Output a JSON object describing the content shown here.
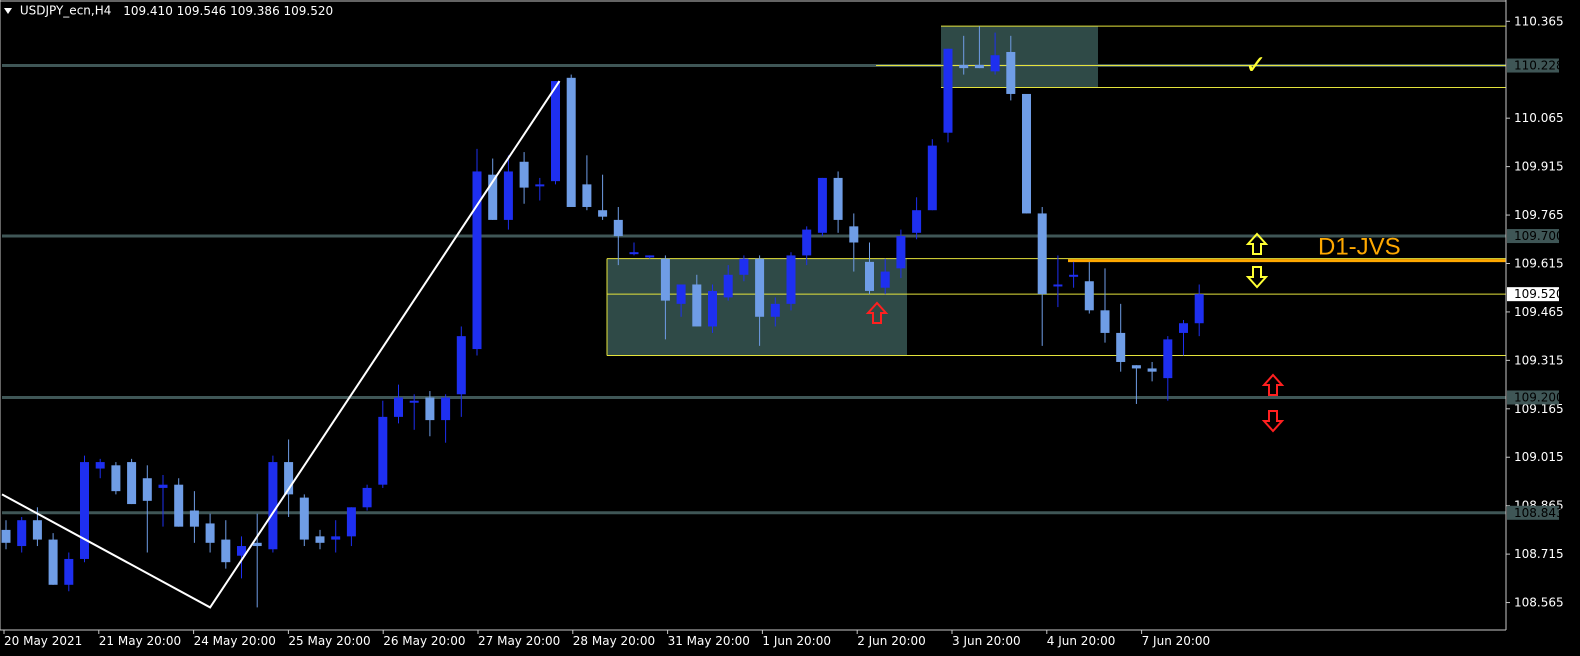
{
  "header": {
    "symbol": "USDJPY_ecn,H4",
    "ohlc": "109.410 109.546 109.386 109.520"
  },
  "colors": {
    "background": "#000000",
    "bull_body": "#1e2ff0",
    "bear_body": "#6f9de6",
    "grid_line": "#3f5656",
    "zone_fill": "#2f4a47",
    "yellow_line": "#e4e33c",
    "orange_line": "#ffa800",
    "arrow_yellow": "#ffff33",
    "arrow_red": "#ff2020"
  },
  "chart_data": {
    "type": "candlestick",
    "y_axis": {
      "min": 108.48,
      "max": 110.4,
      "ticks": [
        "110.365",
        "110.065",
        "109.915",
        "109.765",
        "109.615",
        "109.465",
        "109.315",
        "109.165",
        "109.015",
        "108.865",
        "108.715",
        "108.565"
      ]
    },
    "x_axis": {
      "labels": [
        "20 May 2021",
        "21 May 20:00",
        "24 May 20:00",
        "25 May 20:00",
        "26 May 20:00",
        "27 May 20:00",
        "28 May 20:00",
        "31 May 20:00",
        "1 Jun 20:00",
        "2 Jun 20:00",
        "3 Jun 20:00",
        "4 Jun 20:00",
        "7 Jun 20:00"
      ]
    },
    "horizontal_levels": [
      {
        "value": 110.228,
        "label": "110.228"
      },
      {
        "value": 109.7,
        "label": "109.700"
      },
      {
        "value": 109.2,
        "label": "109.200"
      },
      {
        "value": 108.843,
        "label": "108.843"
      }
    ],
    "current_price": {
      "value": 109.52,
      "label": "109.520"
    },
    "annotation": {
      "text": "D1-JVS",
      "value": 109.624
    },
    "candles": [
      [
        108.79,
        108.82,
        108.73,
        108.75
      ],
      [
        108.74,
        108.83,
        108.72,
        108.82
      ],
      [
        108.82,
        108.86,
        108.74,
        108.76
      ],
      [
        108.76,
        108.78,
        108.62,
        108.62
      ],
      [
        108.62,
        108.72,
        108.6,
        108.7
      ],
      [
        108.7,
        109.02,
        108.69,
        109.0
      ],
      [
        108.98,
        109.01,
        108.95,
        109.0
      ],
      [
        108.99,
        109.0,
        108.9,
        108.91
      ],
      [
        109.0,
        109.01,
        108.87,
        108.87
      ],
      [
        108.95,
        108.99,
        108.72,
        108.88
      ],
      [
        108.92,
        108.96,
        108.8,
        108.93
      ],
      [
        108.93,
        108.95,
        108.8,
        108.8
      ],
      [
        108.85,
        108.91,
        108.75,
        108.8
      ],
      [
        108.81,
        108.84,
        108.72,
        108.75
      ],
      [
        108.76,
        108.82,
        108.67,
        108.69
      ],
      [
        108.71,
        108.77,
        108.64,
        108.74
      ],
      [
        108.75,
        108.84,
        108.55,
        108.74
      ],
      [
        108.73,
        109.02,
        108.72,
        109.0
      ],
      [
        109.0,
        109.07,
        108.83,
        108.9
      ],
      [
        108.89,
        108.9,
        108.74,
        108.76
      ],
      [
        108.77,
        108.79,
        108.73,
        108.75
      ],
      [
        108.76,
        108.82,
        108.72,
        108.77
      ],
      [
        108.77,
        108.86,
        108.74,
        108.86
      ],
      [
        108.86,
        108.93,
        108.85,
        108.92
      ],
      [
        108.93,
        109.19,
        108.92,
        109.14
      ],
      [
        109.14,
        109.24,
        109.12,
        109.2
      ],
      [
        109.19,
        109.21,
        109.1,
        109.19
      ],
      [
        109.2,
        109.22,
        109.08,
        109.13
      ],
      [
        109.13,
        109.21,
        109.06,
        109.2
      ],
      [
        109.21,
        109.42,
        109.14,
        109.39
      ],
      [
        109.35,
        109.97,
        109.33,
        109.9
      ],
      [
        109.89,
        109.94,
        109.75,
        109.75
      ],
      [
        109.75,
        109.95,
        109.72,
        109.9
      ],
      [
        109.93,
        109.96,
        109.8,
        109.85
      ],
      [
        109.86,
        109.88,
        109.81,
        109.86
      ],
      [
        109.87,
        110.18,
        109.86,
        110.18
      ],
      [
        110.19,
        110.2,
        109.81,
        109.79
      ],
      [
        109.86,
        109.95,
        109.78,
        109.79
      ],
      [
        109.78,
        109.89,
        109.75,
        109.76
      ],
      [
        109.75,
        109.79,
        109.61,
        109.7
      ],
      [
        109.65,
        109.68,
        109.64,
        109.65
      ],
      [
        109.64,
        109.64,
        109.63,
        109.64
      ],
      [
        109.63,
        109.64,
        109.38,
        109.5
      ],
      [
        109.49,
        109.55,
        109.45,
        109.55
      ],
      [
        109.55,
        109.58,
        109.42,
        109.42
      ],
      [
        109.42,
        109.55,
        109.4,
        109.53
      ],
      [
        109.51,
        109.61,
        109.5,
        109.58
      ],
      [
        109.58,
        109.64,
        109.56,
        109.63
      ],
      [
        109.63,
        109.64,
        109.36,
        109.45
      ],
      [
        109.45,
        109.51,
        109.42,
        109.49
      ],
      [
        109.49,
        109.65,
        109.47,
        109.64
      ],
      [
        109.64,
        109.73,
        109.61,
        109.72
      ],
      [
        109.71,
        109.88,
        109.7,
        109.88
      ],
      [
        109.88,
        109.9,
        109.71,
        109.75
      ],
      [
        109.73,
        109.77,
        109.59,
        109.68
      ],
      [
        109.62,
        109.68,
        109.52,
        109.53
      ],
      [
        109.54,
        109.63,
        109.52,
        109.59
      ],
      [
        109.6,
        109.72,
        109.57,
        109.7
      ],
      [
        109.71,
        109.82,
        109.69,
        109.78
      ],
      [
        109.78,
        110.0,
        109.78,
        109.98
      ],
      [
        110.02,
        110.28,
        109.99,
        110.28
      ],
      [
        110.23,
        110.32,
        110.2,
        110.22
      ],
      [
        110.23,
        110.35,
        110.22,
        110.22
      ],
      [
        110.21,
        110.33,
        110.2,
        110.26
      ],
      [
        110.27,
        110.32,
        110.12,
        110.14
      ],
      [
        110.14,
        110.14,
        109.77,
        109.77
      ],
      [
        109.77,
        109.79,
        109.36,
        109.52
      ],
      [
        109.55,
        109.64,
        109.48,
        109.55
      ],
      [
        109.58,
        109.62,
        109.54,
        109.58
      ],
      [
        109.56,
        109.62,
        109.46,
        109.47
      ],
      [
        109.47,
        109.6,
        109.37,
        109.4
      ],
      [
        109.4,
        109.49,
        109.28,
        109.31
      ],
      [
        109.3,
        109.3,
        109.18,
        109.29
      ],
      [
        109.29,
        109.31,
        109.25,
        109.28
      ],
      [
        109.26,
        109.39,
        109.19,
        109.38
      ],
      [
        109.4,
        109.44,
        109.33,
        109.43
      ],
      [
        109.43,
        109.55,
        109.39,
        109.52
      ]
    ]
  }
}
